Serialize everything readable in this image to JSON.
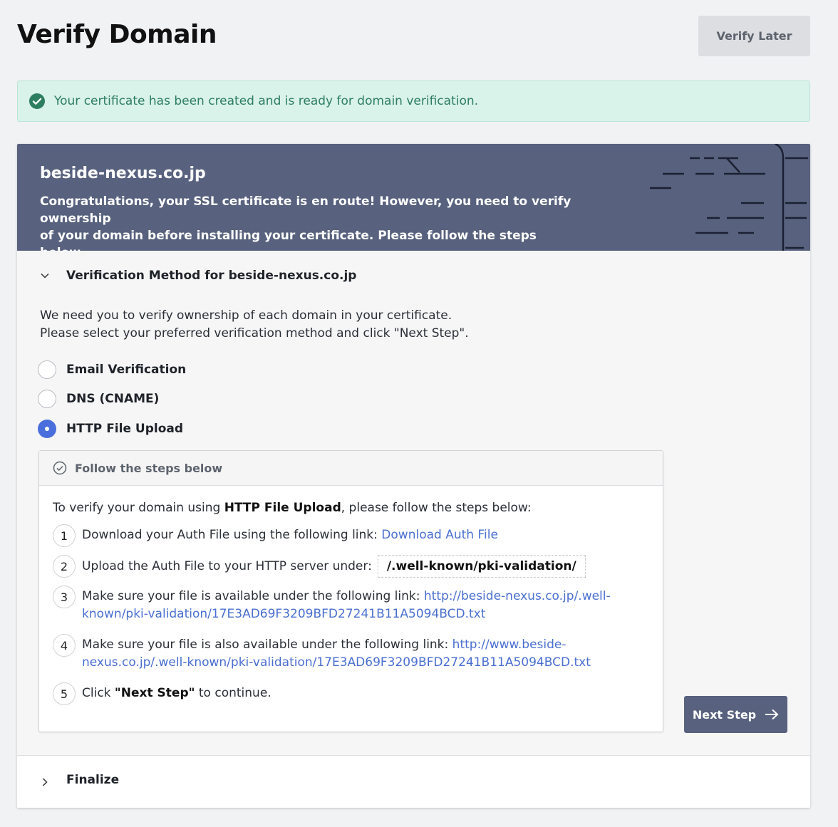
{
  "page": {
    "title": "Verify Domain",
    "verify_later_label": "Verify Later"
  },
  "alert": {
    "icon": "check-circle-icon",
    "text": "Your certificate has been created and is ready for domain verification."
  },
  "card": {
    "domain": "beside-nexus.co.jp",
    "message_line1": "Congratulations, your SSL certificate is en route! However, you need to verify ownership",
    "message_line2": "of your domain before installing your certificate. Please follow the steps below."
  },
  "verification": {
    "section_title": "Verification Method for beside-nexus.co.jp",
    "intro_line1": "We need you to verify ownership of each domain in your certificate.",
    "intro_line2": "Please select your preferred verification method and click \"Next Step\".",
    "options": [
      {
        "label": "Email Verification",
        "selected": false
      },
      {
        "label": "DNS (CNAME)",
        "selected": false
      },
      {
        "label": "HTTP File Upload",
        "selected": true
      }
    ]
  },
  "steps": {
    "header": "Follow the steps below",
    "intro_prefix": "To verify your domain using ",
    "intro_method": "HTTP File Upload",
    "intro_suffix": ", please follow the steps below:",
    "items": [
      {
        "num": "1",
        "text": "Download your Auth File using the following link: ",
        "link": "Download Auth File"
      },
      {
        "num": "2",
        "text": "Upload the Auth File to your HTTP server under:",
        "code": "/.well-known/pki-validation/"
      },
      {
        "num": "3",
        "text": "Make sure your file is available under the following link: ",
        "link_line1": "http://beside-nexus.co.jp/.well-",
        "link_line2": "known/pki-validation/17E3AD69F3209BFD27241B11A5094BCD.txt"
      },
      {
        "num": "4",
        "text": "Make sure your file is also available under the following link: ",
        "link_line1": "http://www.beside-",
        "link_line2": "nexus.co.jp/.well-known/pki-validation/17E3AD69F3209BFD27241B11A5094BCD.txt"
      },
      {
        "num": "5",
        "text_prefix": "Click ",
        "text_bold": "\"Next Step\"",
        "text_suffix": " to continue."
      }
    ]
  },
  "next_step_label": "Next Step",
  "finalize_label": "Finalize",
  "colors": {
    "header_bg": "#58627e",
    "accent": "#4a6fdc",
    "success": "#2d7e61",
    "link": "#4a6fd0"
  }
}
